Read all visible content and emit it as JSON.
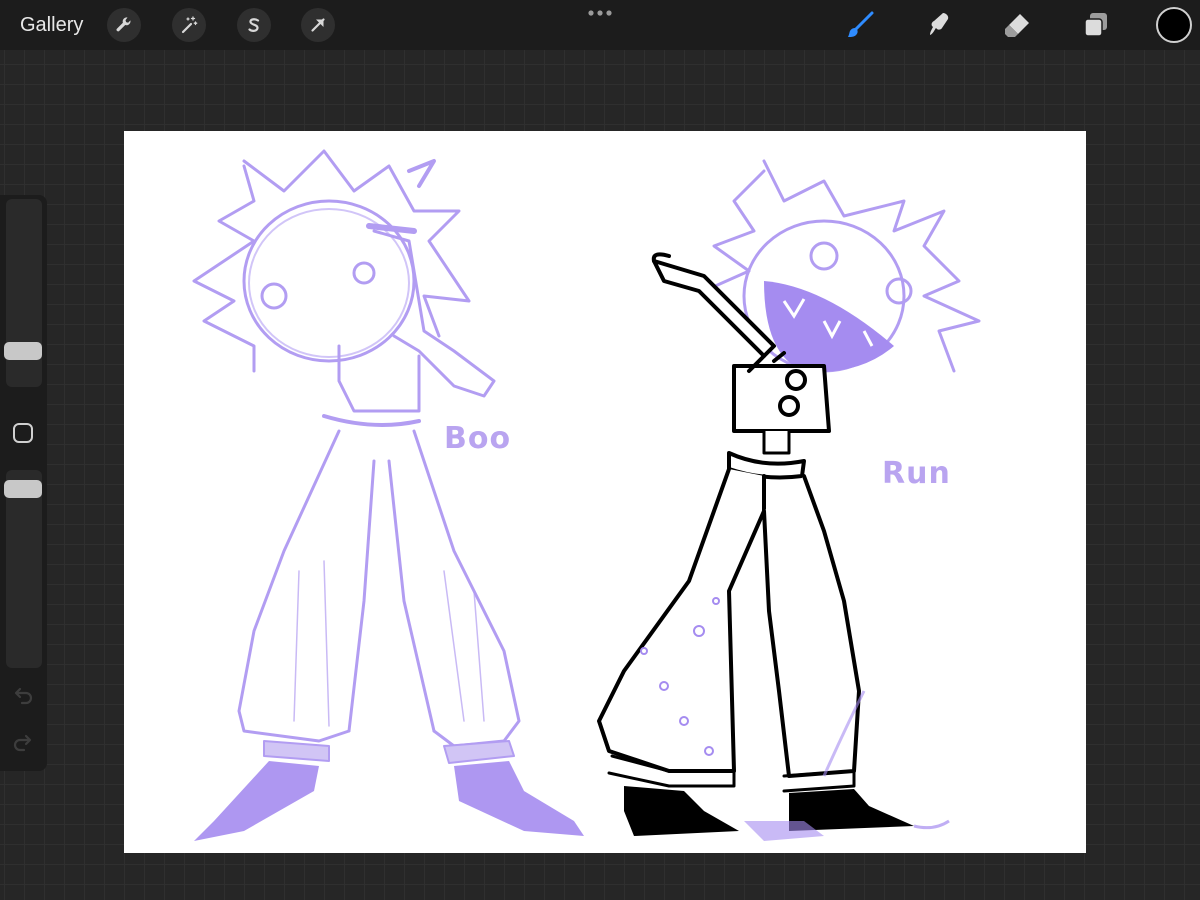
{
  "topbar": {
    "gallery_label": "Gallery",
    "left_tools": [
      {
        "name": "actions",
        "icon": "wrench-icon"
      },
      {
        "name": "adjustments",
        "icon": "magic-wand-icon"
      },
      {
        "name": "selection",
        "icon": "selection-s-icon"
      },
      {
        "name": "transform",
        "icon": "arrow-cursor-icon"
      }
    ],
    "right_tools": [
      {
        "name": "brush",
        "icon": "brush-icon",
        "active": true
      },
      {
        "name": "smudge",
        "icon": "smudge-icon"
      },
      {
        "name": "eraser",
        "icon": "eraser-icon"
      },
      {
        "name": "layers",
        "icon": "layers-icon"
      }
    ],
    "active_color": "#000000"
  },
  "sidebar": {
    "brush_size_level": 0.5,
    "opacity_level": 0.95,
    "undo_icon": "undo-icon",
    "redo_icon": "redo-icon"
  },
  "canvas": {
    "background": "#ffffff",
    "labels": {
      "left_character": "Boo",
      "right_character": "Run"
    },
    "sketch_color": "#a58cf0",
    "lineart_color": "#000000"
  }
}
